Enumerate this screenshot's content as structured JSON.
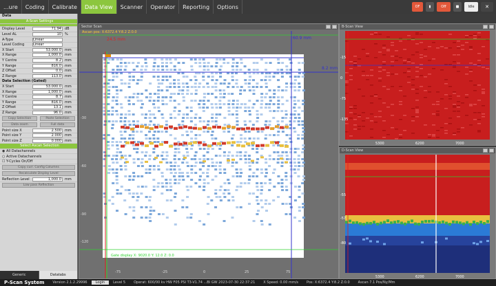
{
  "menu": {
    "tabs": [
      "...ure",
      "Coding",
      "Calibrate",
      "Data View",
      "Scanner",
      "Operator",
      "Reporting",
      "Options"
    ],
    "active_index": 3
  },
  "top_buttons": {
    "btn1": "OF",
    "btn2": "Off",
    "btn3": "Idle"
  },
  "left_panel": {
    "section_data": "Data",
    "ascan_label": "A-Scan Settings",
    "display_level_label": "Display Level",
    "display_level_value": "71.94",
    "display_level_unit": "dB",
    "level_al_label": "Level AL",
    "level_al_value": "10",
    "level_al_unit": "%",
    "a_type_label": "A-Type",
    "a_type_value": "Linear",
    "level_coding_label": "Level Coding",
    "level_coding_value": "Linear",
    "x_start_label": "X Start",
    "x_start_value": "53.000.0",
    "x_range_label": "X Range",
    "x_range_value": "1,000.0",
    "y_centre_label": "Y Centre",
    "y_centre_value": "8.2",
    "y_range_label": "Y Range",
    "y_range_value": "816.0",
    "z_offset_label": "Z Offset",
    "z_offset_value": "0.0",
    "z_range_label": "Z Range",
    "z_range_value": "113.0",
    "unit_mm": "mm",
    "data_selection_header": "Data Selection (Gated)",
    "x_start2_value": "53.000.0",
    "x_range2_value": "1,000.0",
    "y_centre2_value": "8.7",
    "y_range2_value": "816.0",
    "z_offset2_value": "13.1",
    "z_range2_value": "96.0",
    "copy_btn": "Copy Selection",
    "paste_btn": "Paste Selection",
    "zoom_btn": "Data zoom",
    "full_btn": "Full data",
    "point_size_x_label": "Point size X",
    "point_size_x_value": "2.500",
    "point_size_y_label": "Point size Y",
    "point_size_y_value": "2.000",
    "point_size_z_label": "Point size Z",
    "point_size_z_value": "0.000",
    "ascan_selection": "Select Ascan Selection",
    "opt1": "All Datachannels",
    "opt2": "Active Datachannels",
    "opt3": "Y-Cycles On/Off",
    "copy_curr_btn": "Copy curr. Config Columns",
    "calc_btn": "Recalculate Display Level",
    "reflection_label": "Reflection Level",
    "reflection_value": "1,000.0",
    "low_pass_label": "Low pass Reflection",
    "foot_tab1": "Generic",
    "foot_tab2": "Datatabs"
  },
  "main_view": {
    "title": "Sector Scan",
    "ascan_readout": "Ascan pos: X:6372.4 Y:8.2 Z:0.0",
    "depth_marker_top": "24.5 mm",
    "depth_marker_right": "60.9 mm",
    "depth_marker_side": "8.2 mm",
    "bottom_readout": "Gate display X: 9020.0 Y: 12.0 Z:  0.0",
    "x_ticks": [
      "-75",
      "-25",
      "0",
      "25",
      "75"
    ],
    "y_ticks": [
      "-30",
      "-60",
      "-90",
      "-120"
    ]
  },
  "top_right_view": {
    "title": "B-Scan View",
    "y_ticks": [
      "-15",
      "0",
      "-75",
      "-135"
    ],
    "x_ticks": [
      "5300",
      "6200",
      "7000"
    ]
  },
  "bottom_right_view": {
    "title": "D-Scan View",
    "y_ticks": [
      "-55",
      "-57",
      "-80"
    ],
    "x_ticks": [
      "5300",
      "6200",
      "7000"
    ]
  },
  "status": {
    "app_name": "P-Scan System",
    "version": "Version 2.1.2.29996",
    "login": "Login",
    "level": "Level 5",
    "operator": "Operat: 600/00 kv HW F05 PSI T3-V1.74 ...BI GW 2023-07-30 22:37:21",
    "scan_speed": "X Speed: 0.00 mm/s",
    "pos": "Pos: X:6372.4 Y:8.2 Z:0.0",
    "speed2": "Ascan 7.1 Pos/Ny/Mm"
  },
  "colors": {
    "accent": "#8cc63e",
    "menubar": "#3a3a3a",
    "panel_bg": "#d6d6d6",
    "cursor_blue": "#3333cc",
    "cursor_green": "#2fd02f",
    "cursor_red": "#e02020"
  }
}
